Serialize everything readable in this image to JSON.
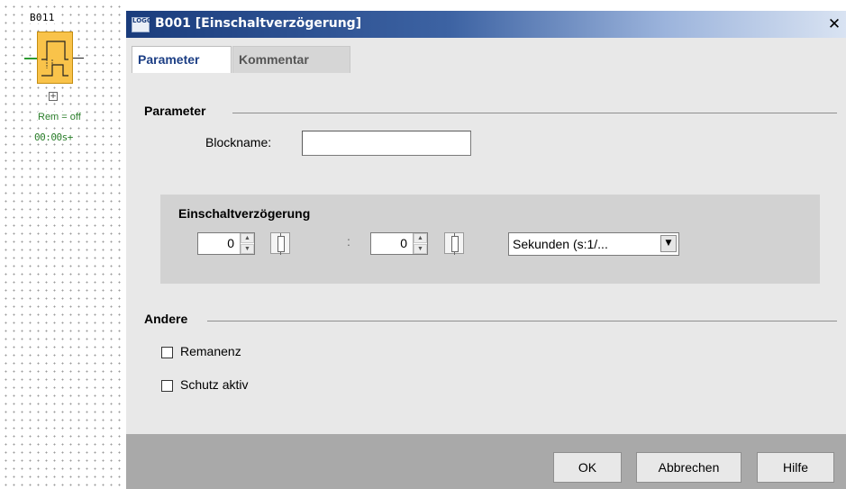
{
  "canvas": {
    "block": {
      "name": "B011",
      "expand_symbol": "+",
      "remanence_label": "Rem = off",
      "time_label": "00:00s+"
    }
  },
  "dialog": {
    "title": "B001 [Einschaltverzögerung]",
    "logo_text": "LOGO",
    "close_symbol": "✕",
    "tabs": [
      {
        "label": "Parameter",
        "active": true
      },
      {
        "label": "Kommentar",
        "active": false
      }
    ],
    "parameter_section": {
      "heading": "Parameter",
      "blockname_label": "Blockname:",
      "blockname_value": ""
    },
    "delay_group": {
      "heading": "Einschaltverzögerung",
      "value1": "0",
      "separator": ":",
      "value2": "0",
      "unit_selected": "Sekunden (s:1/..."
    },
    "other_section": {
      "heading": "Andere",
      "checkboxes": [
        {
          "label": "Remanenz",
          "checked": false
        },
        {
          "label": "Schutz aktiv",
          "checked": false
        }
      ]
    },
    "buttons": {
      "ok": "OK",
      "cancel": "Abbrechen",
      "help": "Hilfe"
    }
  }
}
